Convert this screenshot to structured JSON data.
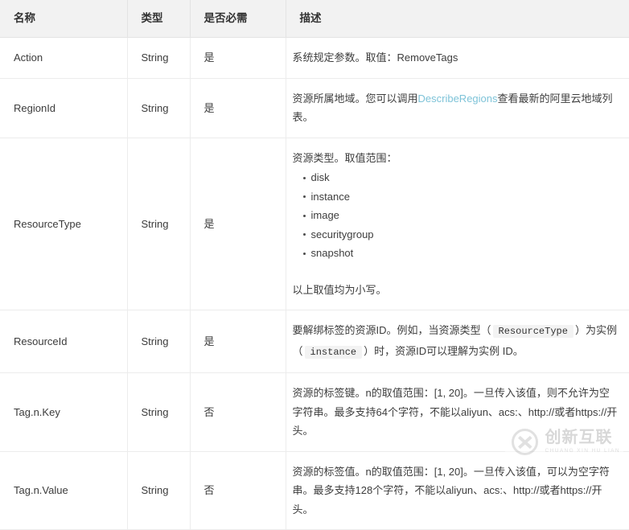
{
  "table": {
    "headers": {
      "name": "名称",
      "type": "类型",
      "required": "是否必需",
      "description": "描述"
    },
    "rows": [
      {
        "name": "Action",
        "type": "String",
        "required": "是",
        "desc_line1": "系统规定参数。取值：RemoveTags"
      },
      {
        "name": "RegionId",
        "type": "String",
        "required": "是",
        "desc_before_link": "资源所属地域。您可以调用",
        "desc_link": "DescribeRegions",
        "desc_after_link": "查看最新的阿里云地域列表。"
      },
      {
        "name": "ResourceType",
        "type": "String",
        "required": "是",
        "desc_intro": "资源类型。取值范围：",
        "desc_items": [
          "disk",
          "instance",
          "image",
          "securitygroup",
          "snapshot"
        ],
        "desc_outro": "以上取值均为小写。"
      },
      {
        "name": "ResourceId",
        "type": "String",
        "required": "是",
        "desc_part1": "要解绑标签的资源ID。例如，当资源类型（",
        "desc_code1": "ResourceType",
        "desc_part2": "）为实例（",
        "desc_code2": "instance",
        "desc_part3": "）时，资源ID可以理解为实例 ID。"
      },
      {
        "name": "Tag.n.Key",
        "type": "String",
        "required": "否",
        "desc_line1": "资源的标签键。n的取值范围：[1, 20]。一旦传入该值，则不允许为空字符串。最多支持64个字符，不能以aliyun、acs:、http://或者https://开头。"
      },
      {
        "name": "Tag.n.Value",
        "type": "String",
        "required": "否",
        "desc_line1": "资源的标签值。n的取值范围：[1, 20]。一旦传入该值，可以为空字符串。最多支持128个字符，不能以aliyun、acs:、http://或者https://开头。"
      }
    ]
  },
  "watermark": {
    "logo": "cx-circle-logo",
    "cn": "创新互联",
    "en": "CHUANG XIN HU LIAN"
  },
  "colors": {
    "header_bg": "#f2f2f2",
    "border": "#ececec",
    "link": "#7ec3d8",
    "code_bg": "#f3f3f3",
    "text": "#333333"
  }
}
